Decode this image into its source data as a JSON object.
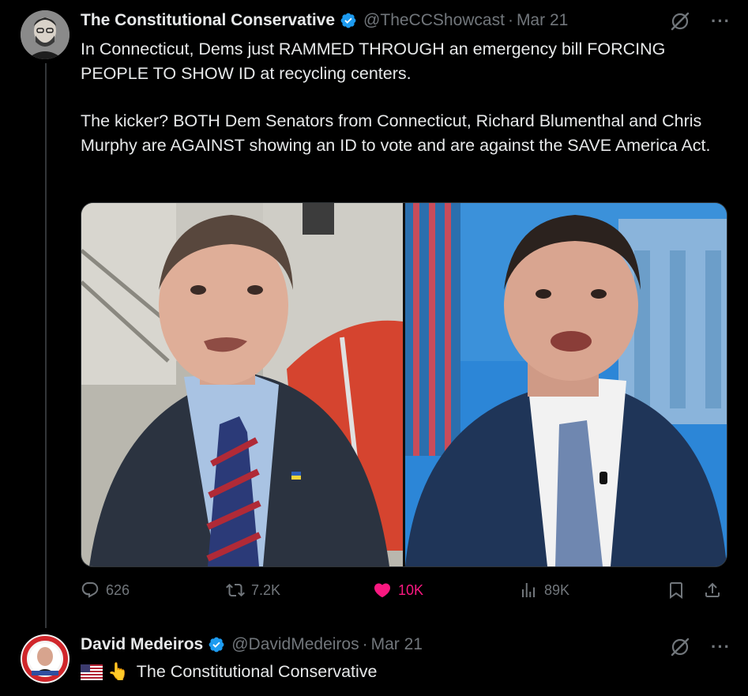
{
  "tweet": {
    "author_name": "The Constitutional Conservative",
    "author_handle": "@TheCCShowcast",
    "separator": "·",
    "date": "Mar 21",
    "text_p1": "In Connecticut, Dems just RAMMED THROUGH an emergency bill FORCING PEOPLE TO SHOW ID at recycling centers.",
    "text_p2": "The kicker? BOTH Dem Senators from Connecticut, Richard Blumenthal and Chris Murphy are AGAINST showing an ID to vote and are against the SAVE America Act.",
    "verified": true,
    "actions": {
      "replies": "626",
      "reposts": "7.2K",
      "likes": "10K",
      "views": "89K"
    },
    "liked": true
  },
  "reply": {
    "author_name": "David Medeiros",
    "author_handle": "@DavidMedeiros",
    "separator": "·",
    "date": "Mar 21",
    "emoji": "👆",
    "text": "The Constitutional Conservative"
  },
  "colors": {
    "background": "#000000",
    "text": "#e7e9ea",
    "muted": "#71767b",
    "verified": "#1d9bf0",
    "like": "#f91880"
  }
}
